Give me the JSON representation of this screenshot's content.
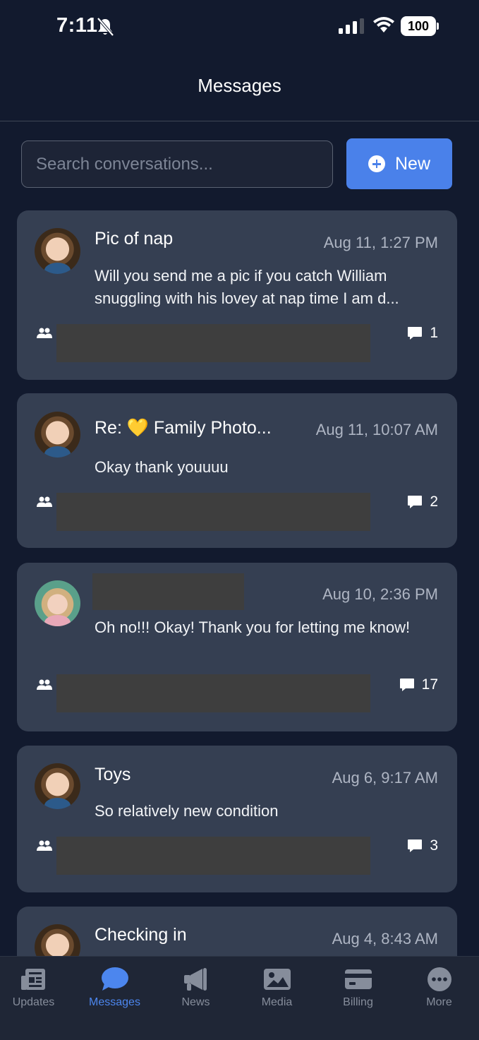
{
  "status_bar": {
    "time": "7:11",
    "battery": "100"
  },
  "header": {
    "title": "Messages"
  },
  "search": {
    "placeholder": "Search conversations..."
  },
  "new_button": {
    "label": "New"
  },
  "conversations": [
    {
      "title": "Pic of nap",
      "time": "Aug 11, 1:27 PM",
      "preview": "Will you send me a pic if you catch William snuggling with his lovey at nap time I am d...",
      "comments": "1"
    },
    {
      "title": "Re: 💛 Family Photo...",
      "time": "Aug 11, 10:07 AM",
      "preview": "Okay thank youuuu",
      "comments": "2"
    },
    {
      "title": "",
      "time": "Aug 10, 2:36 PM",
      "preview": "Oh no!!! Okay! Thank you for letting me know!",
      "comments": "17"
    },
    {
      "title": "Toys",
      "time": "Aug 6, 9:17 AM",
      "preview": "So relatively new condition",
      "comments": "3"
    },
    {
      "title": "Checking in",
      "time": "Aug 4, 8:43 AM"
    }
  ],
  "tabs": [
    {
      "label": "Updates",
      "icon": "updates-icon",
      "active": false
    },
    {
      "label": "Messages",
      "icon": "messages-icon",
      "active": true
    },
    {
      "label": "News",
      "icon": "megaphone-icon",
      "active": false
    },
    {
      "label": "Media",
      "icon": "image-icon",
      "active": false
    },
    {
      "label": "Billing",
      "icon": "credit-card-icon",
      "active": false
    },
    {
      "label": "More",
      "icon": "more-icon",
      "active": false
    }
  ],
  "colors": {
    "background": "#121a2e",
    "card": "#353f52",
    "accent": "#4a81ea",
    "tab_inactive": "#868d9b"
  }
}
